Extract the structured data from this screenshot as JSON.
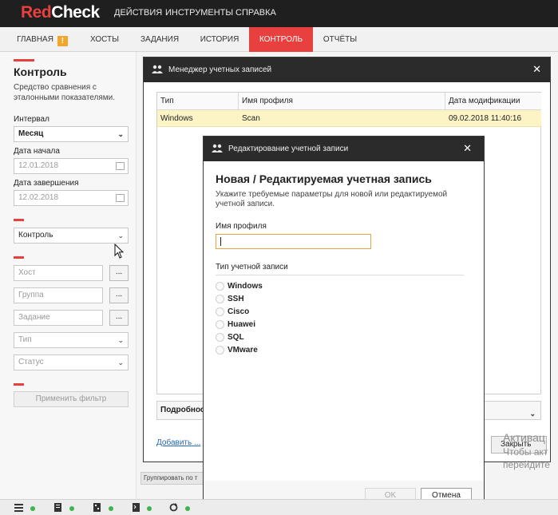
{
  "app": {
    "logo_red": "Red",
    "logo_white": "Check"
  },
  "topmenu": [
    "ДЕЙСТВИЯ",
    "ИНСТРУМЕНТЫ",
    "СПРАВКА"
  ],
  "tabs": [
    {
      "label": "ГЛАВНАЯ",
      "active": false,
      "badge": "!"
    },
    {
      "label": "ХОСТЫ",
      "active": false
    },
    {
      "label": "ЗАДАНИЯ",
      "active": false
    },
    {
      "label": "ИСТОРИЯ",
      "active": false
    },
    {
      "label": "КОНТРОЛЬ",
      "active": true
    },
    {
      "label": "ОТЧЁТЫ",
      "active": false
    }
  ],
  "sidebar": {
    "title": "Контроль",
    "description": "Средство сравнения с эталонными показателями.",
    "interval_label": "Интервал",
    "interval_value": "Месяц",
    "start_label": "Дата начала",
    "start_value": "12.01.2018",
    "end_label": "Дата завершения",
    "end_value": "12.02.2018",
    "mode_value": "Контроль",
    "host_placeholder": "Хост",
    "group_placeholder": "Группа",
    "task_placeholder": "Задание",
    "type_placeholder": "Тип",
    "status_placeholder": "Статус",
    "browse_label": "...",
    "apply_label": "Применить фильтр"
  },
  "group_bar": "Группировать по т",
  "manager": {
    "title": "Менеджер учетных записей",
    "columns": [
      "Тип",
      "Имя профиля",
      "Дата модификации"
    ],
    "rows": [
      {
        "type": "Windows",
        "profile": "Scan",
        "modified": "09.02.2018 11:40:16"
      }
    ],
    "details_label": "Подробнос",
    "add_link": "Добавить ...",
    "close_label": "Закрыть"
  },
  "edit": {
    "title": "Редактирование учетной записи",
    "heading": "Новая / Редактируемая учетная запись",
    "subtitle": "Укажите требуемые параметры для новой или редактируемой учетной записи.",
    "profile_label": "Имя профиля",
    "profile_value": "",
    "type_label": "Тип учетной записи",
    "types": [
      "Windows",
      "SSH",
      "Cisco",
      "Huawei",
      "SQL",
      "VMware"
    ],
    "ok_label": "OK",
    "cancel_label": "Отмена"
  },
  "watermark": {
    "line1": "Активац",
    "line2": "Чтобы акт",
    "line3": "перейдите"
  },
  "colors": {
    "accent": "#e8403f",
    "warning": "#f2a62c",
    "status_ok": "#3db54a",
    "selection": "#fdf4c6"
  }
}
